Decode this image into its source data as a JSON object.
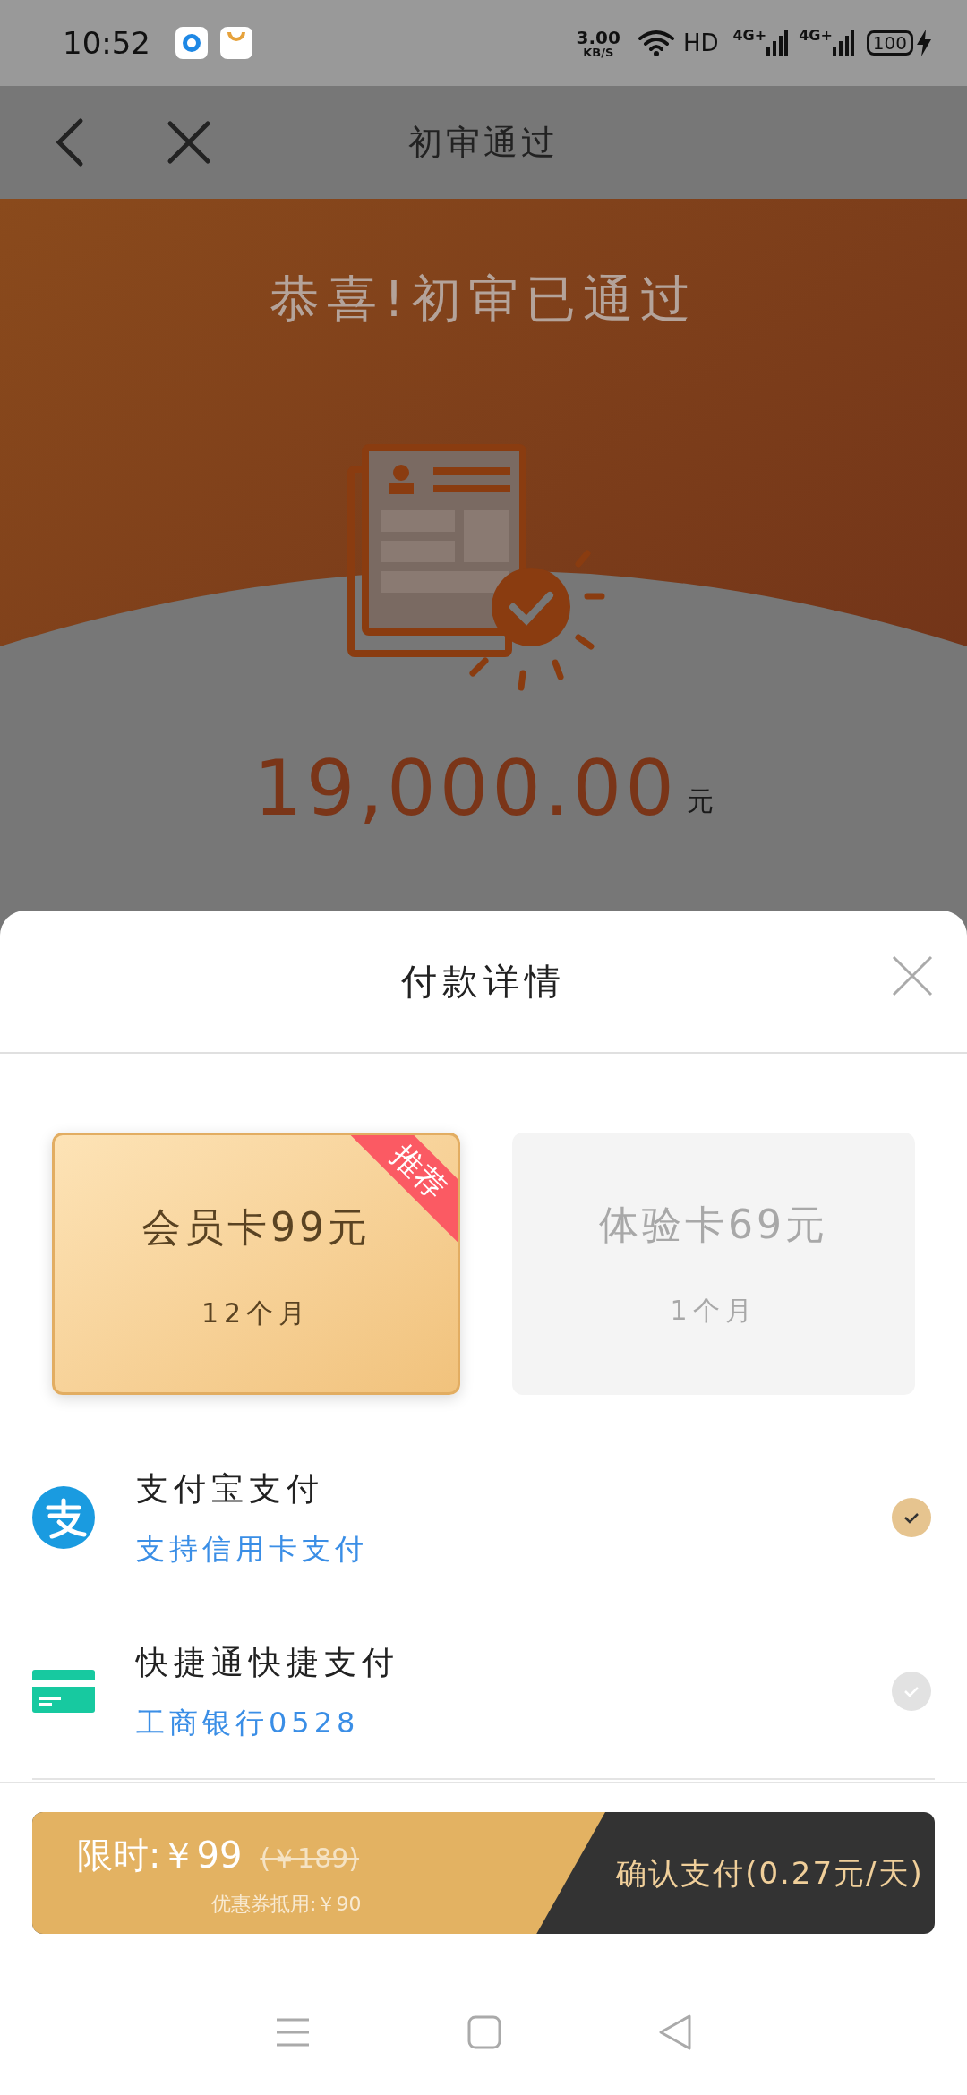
{
  "status_bar": {
    "time": "10:52",
    "speed_value": "3.00",
    "speed_unit": "KB/S",
    "hd": "HD",
    "network_1": "4G+",
    "network_2": "4G+",
    "battery": "100"
  },
  "header": {
    "title": "初审通过"
  },
  "hero": {
    "headline": "恭喜!初审已通过",
    "amount": "19,000.00",
    "unit": "元"
  },
  "sheet": {
    "title": "付款详情",
    "plans": [
      {
        "name": "会员卡99元",
        "period": "12个月",
        "badge": "推荐",
        "selected": true
      },
      {
        "name": "体验卡69元",
        "period": "1个月",
        "selected": false
      }
    ],
    "methods": [
      {
        "kind": "alipay",
        "name": "支付宝支付",
        "detail": "支持信用卡支付",
        "selected": true
      },
      {
        "kind": "card",
        "name": "快捷通快捷支付",
        "detail": "工商银行0528",
        "selected": false
      }
    ],
    "footer": {
      "price": "限时:￥99",
      "original_price": "(￥189)",
      "coupon": "优惠券抵用:￥90",
      "confirm": "确认支付(0.27元/天)"
    }
  }
}
